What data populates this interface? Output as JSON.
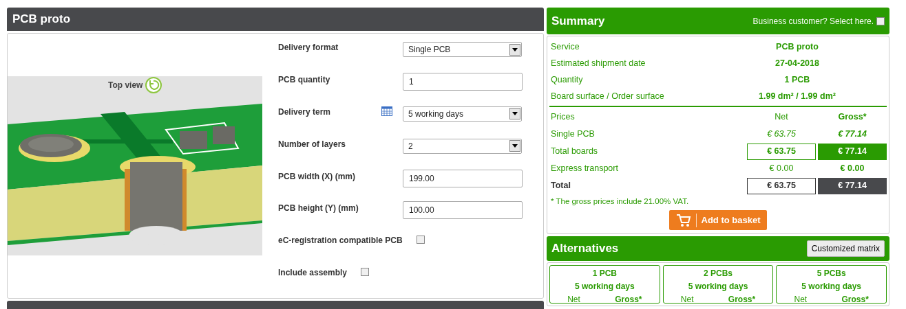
{
  "config_panel": {
    "title": "PCB proto",
    "view_label": "Top view",
    "fields": [
      {
        "kind": "select",
        "label": "Delivery format",
        "value": "Single PCB",
        "calendar": false
      },
      {
        "kind": "input",
        "label": "PCB quantity",
        "value": "1"
      },
      {
        "kind": "select",
        "label": "Delivery term",
        "value": "5 working days",
        "calendar": true
      },
      {
        "kind": "select",
        "label": "Number of layers",
        "value": "2",
        "calendar": false
      },
      {
        "kind": "input",
        "label": "PCB width (X) (mm)",
        "value": "199.00"
      },
      {
        "kind": "input",
        "label": "PCB height (Y) (mm)",
        "value": "100.00"
      },
      {
        "kind": "checkbox",
        "label": "eC-registration compatible PCB",
        "checked": false
      },
      {
        "kind": "checkbox",
        "label": "Include assembly",
        "checked": false
      }
    ]
  },
  "summary": {
    "title": "Summary",
    "business_label": "Business customer? Select here.",
    "business_checked": false,
    "details": [
      {
        "label": "Service",
        "value": "PCB proto"
      },
      {
        "label": "Estimated shipment date",
        "value": "27-04-2018"
      },
      {
        "label": "Quantity",
        "value": "1 PCB"
      },
      {
        "label": "Board surface / Order surface",
        "value": "1.99 dm² / 1.99 dm²"
      }
    ],
    "prices": [
      {
        "kind": "header",
        "label": "Prices",
        "net": "Net",
        "gross": "Gross*"
      },
      {
        "kind": "unit",
        "label": "Single PCB",
        "net": "€ 63.75",
        "gross": "€ 77.14"
      },
      {
        "kind": "boxed",
        "label": "Total boards",
        "net": "€ 63.75",
        "gross": "€ 77.14"
      },
      {
        "kind": "plain",
        "label": "Express transport",
        "net": "€ 0.00",
        "gross": "€ 0.00"
      },
      {
        "kind": "total",
        "label": "Total",
        "net": "€ 63.75",
        "gross": "€ 77.14"
      }
    ],
    "note": "* The gross prices include 21.00% VAT.",
    "basket_button": "Add to basket"
  },
  "alternatives": {
    "title": "Alternatives",
    "matrix_button": "Customized matrix",
    "cards": [
      {
        "quantity": "1 PCB",
        "term": "5 working days",
        "net": "Net",
        "gross": "Gross*"
      },
      {
        "quantity": "2 PCBs",
        "term": "5 working days",
        "net": "Net",
        "gross": "Gross*"
      },
      {
        "quantity": "5 PCBs",
        "term": "5 working days",
        "net": "Net",
        "gross": "Gross*"
      }
    ]
  }
}
